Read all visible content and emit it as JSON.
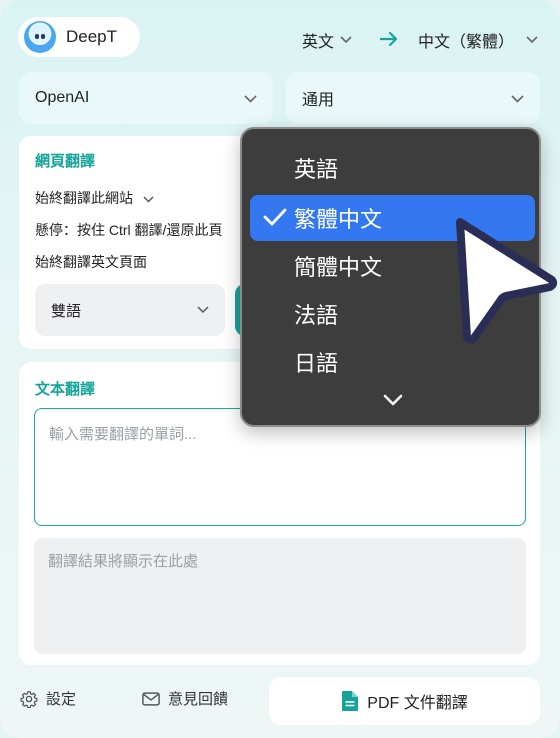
{
  "header": {
    "app_name": "DeepT",
    "source_lang": "英文",
    "target_lang": "中文（繁體）"
  },
  "selects": {
    "model": "OpenAI",
    "mode": "通用"
  },
  "web_translation": {
    "title": "網頁翻譯",
    "option_always_site": "始終翻譯此網站",
    "option_hover": "懸停：按住 Ctrl 翻譯/還原此頁",
    "option_always_english": "始終翻譯英文頁面",
    "display_mode": "雙語"
  },
  "text_translation": {
    "title": "文本翻譯",
    "input_placeholder": "輸入需要翻譯的單詞...",
    "result_placeholder": "翻譯結果將顯示在此處"
  },
  "footer": {
    "settings": "設定",
    "feedback": "意見回饋",
    "pdf": "PDF 文件翻譯"
  },
  "dropdown": {
    "items": [
      "英語",
      "繁體中文",
      "簡體中文",
      "法語",
      "日語"
    ],
    "selected_index": 1
  },
  "colors": {
    "accent": "#17a399",
    "selected": "#3378f0",
    "dropdown_bg": "#3d3d3d"
  }
}
